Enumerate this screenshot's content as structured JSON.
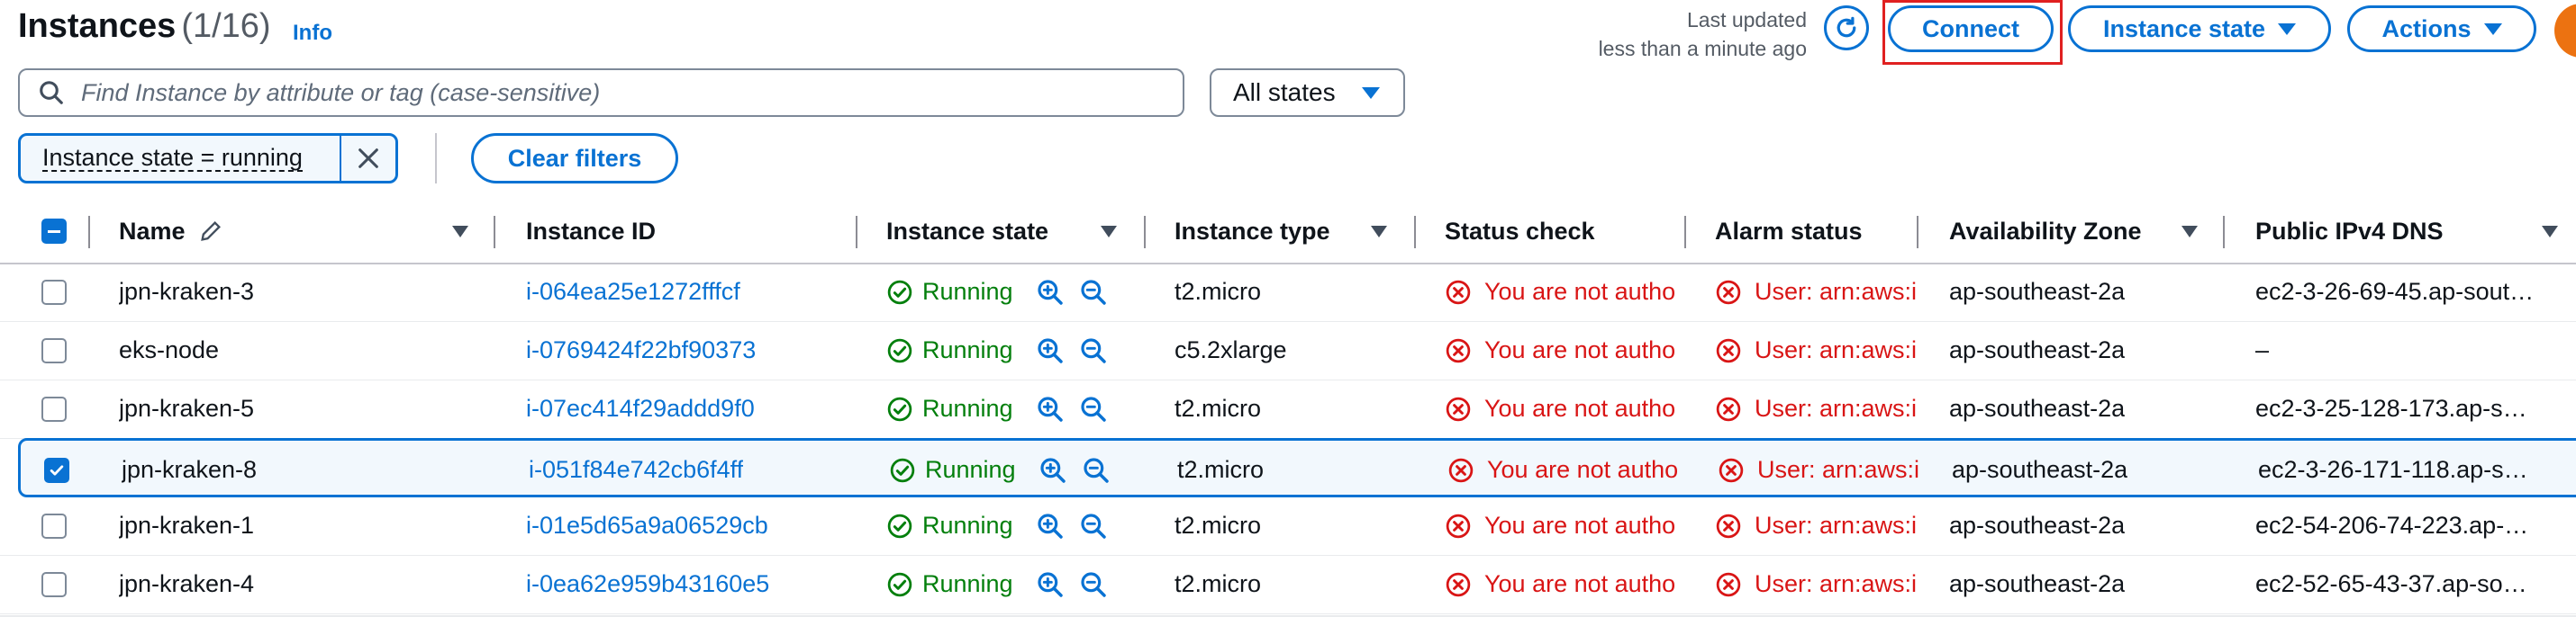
{
  "header": {
    "title": "Instances",
    "count": "(1/16)",
    "info": "Info",
    "last_updated_line1": "Last updated",
    "last_updated_line2": "less than a minute ago",
    "connect": "Connect",
    "instance_state": "Instance state",
    "actions": "Actions"
  },
  "search": {
    "placeholder": "Find Instance by attribute or tag (case-sensitive)"
  },
  "state_select": {
    "value": "All states"
  },
  "filter": {
    "token": "Instance state = running",
    "clear": "Clear filters"
  },
  "columns": [
    "Name",
    "Instance ID",
    "Instance state",
    "Instance type",
    "Status check",
    "Alarm status",
    "Availability Zone",
    "Public IPv4 DNS"
  ],
  "rows": [
    {
      "name": "jpn-kraken-3",
      "id": "i-064ea25e1272fffcf",
      "state": "Running",
      "type": "t2.micro",
      "status": "You are not autho",
      "alarm": "User: arn:aws:i",
      "az": "ap-southeast-2a",
      "dns": "ec2-3-26-69-45.ap-sout…",
      "selected": false
    },
    {
      "name": "eks-node",
      "id": "i-0769424f22bf90373",
      "state": "Running",
      "type": "c5.2xlarge",
      "status": "You are not autho",
      "alarm": "User: arn:aws:i",
      "az": "ap-southeast-2a",
      "dns": "–",
      "selected": false
    },
    {
      "name": "jpn-kraken-5",
      "id": "i-07ec414f29addd9f0",
      "state": "Running",
      "type": "t2.micro",
      "status": "You are not autho",
      "alarm": "User: arn:aws:i",
      "az": "ap-southeast-2a",
      "dns": "ec2-3-25-128-173.ap-s…",
      "selected": false
    },
    {
      "name": "jpn-kraken-8",
      "id": "i-051f84e742cb6f4ff",
      "state": "Running",
      "type": "t2.micro",
      "status": "You are not autho",
      "alarm": "User: arn:aws:i",
      "az": "ap-southeast-2a",
      "dns": "ec2-3-26-171-118.ap-s…",
      "selected": true
    },
    {
      "name": "jpn-kraken-1",
      "id": "i-01e5d65a9a06529cb",
      "state": "Running",
      "type": "t2.micro",
      "status": "You are not autho",
      "alarm": "User: arn:aws:i",
      "az": "ap-southeast-2a",
      "dns": "ec2-54-206-74-223.ap-…",
      "selected": false
    },
    {
      "name": "jpn-kraken-4",
      "id": "i-0ea62e959b43160e5",
      "state": "Running",
      "type": "t2.micro",
      "status": "You are not autho",
      "alarm": "User: arn:aws:i",
      "az": "ap-southeast-2a",
      "dns": "ec2-52-65-43-37.ap-so…",
      "selected": false
    }
  ],
  "colors": {
    "accent": "#0972d3",
    "success": "#037f0c",
    "error": "#d91515",
    "highlight": "#e02020"
  }
}
